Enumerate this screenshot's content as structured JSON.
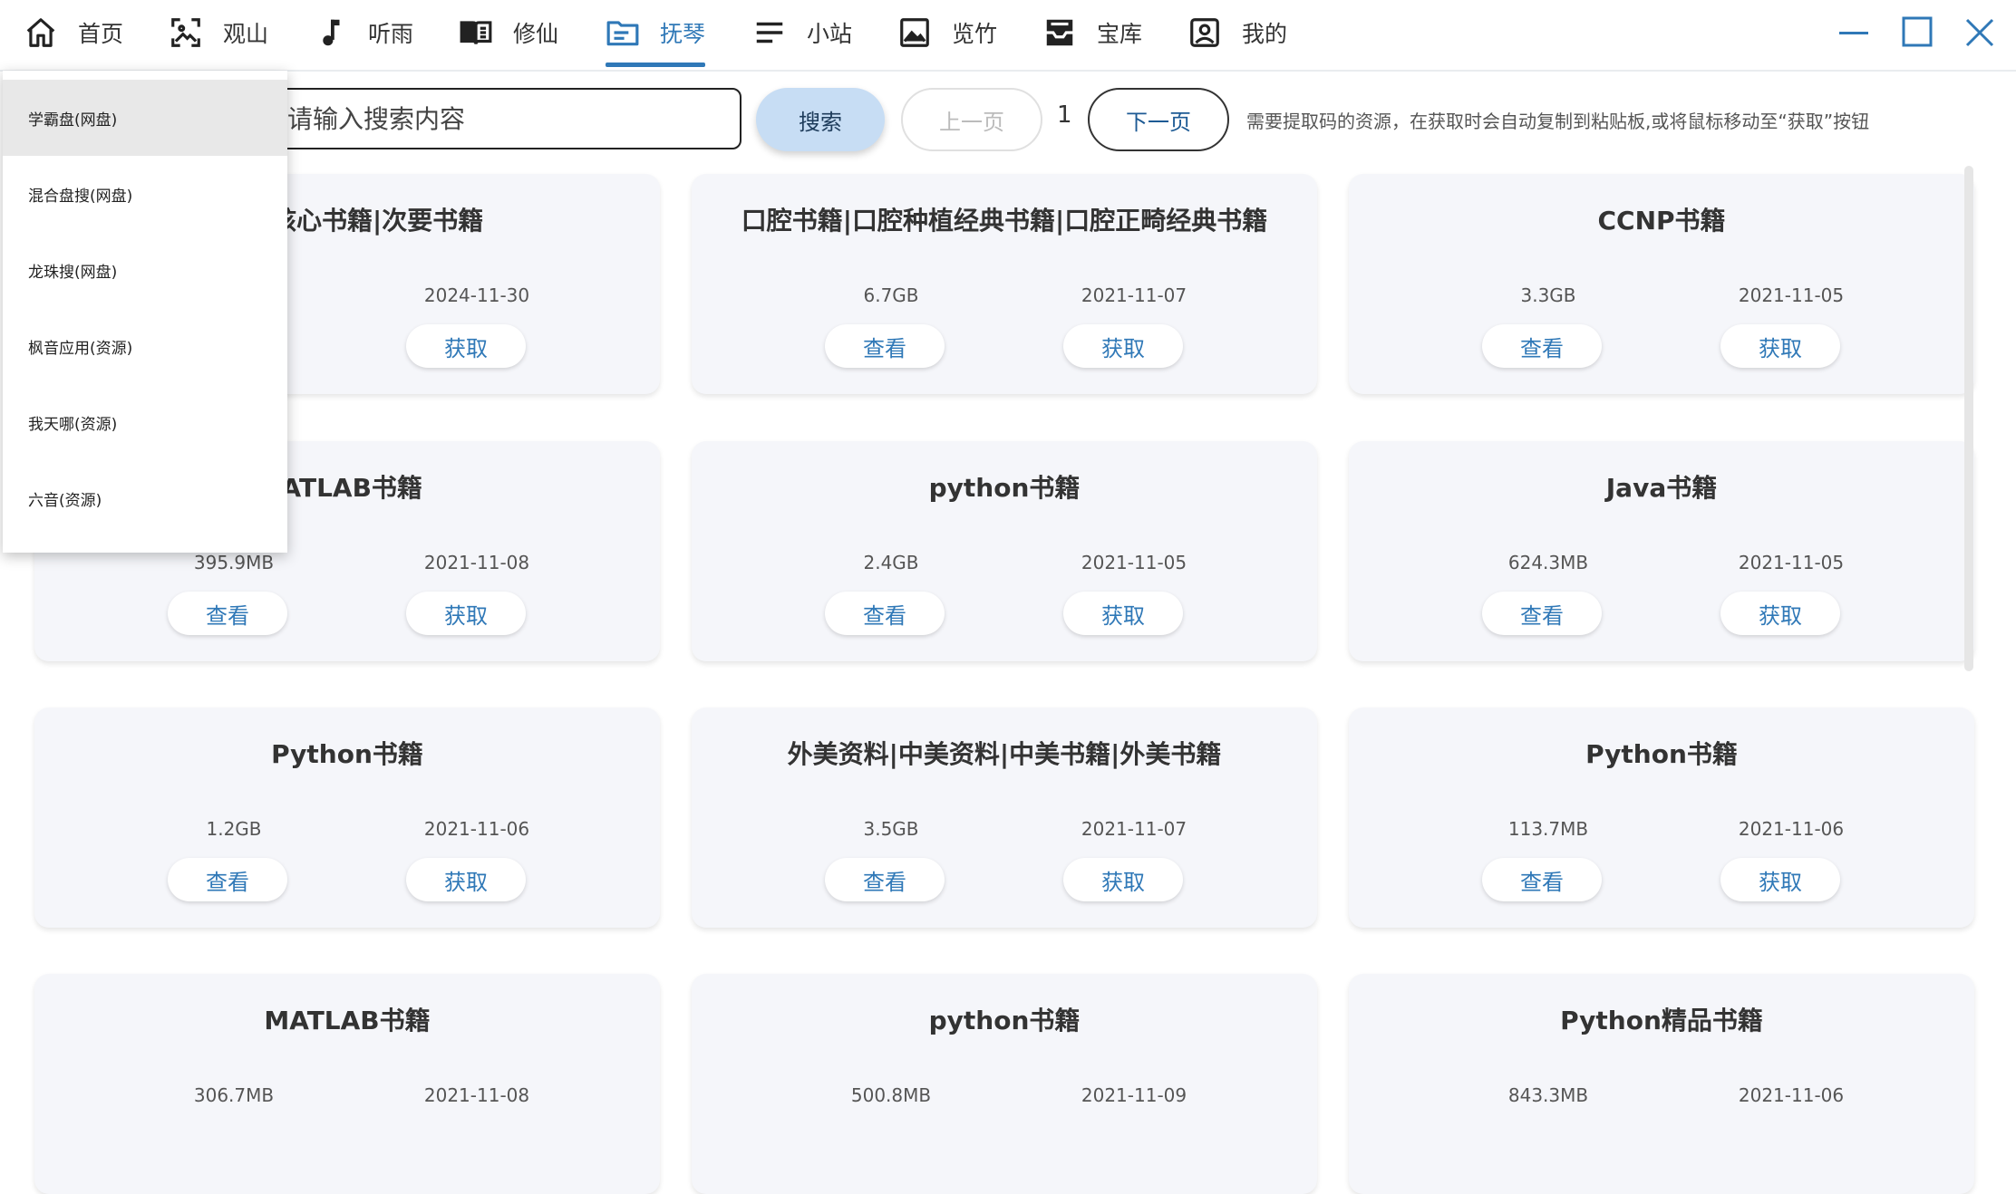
{
  "nav": {
    "items": [
      {
        "label": "首页",
        "icon": "home-icon"
      },
      {
        "label": "观山",
        "icon": "image-frame-icon"
      },
      {
        "label": "听雨",
        "icon": "music-note-icon"
      },
      {
        "label": "修仙",
        "icon": "book-icon"
      },
      {
        "label": "抚琴",
        "icon": "folder-list-icon"
      },
      {
        "label": "小站",
        "icon": "menu-lines-icon"
      },
      {
        "label": "览竹",
        "icon": "picture-icon"
      },
      {
        "label": "宝库",
        "icon": "inbox-icon"
      },
      {
        "label": "我的",
        "icon": "user-badge-icon"
      }
    ],
    "active_index": 4
  },
  "window_controls": [
    "minimize-icon",
    "maximize-icon",
    "close-icon"
  ],
  "colors": {
    "accent": "#2f78b7",
    "search_button_bg": "#c7ddf4",
    "card_bg": "#f5f6fa"
  },
  "toolbar": {
    "search_placeholder": "请输入搜索内容",
    "search_label": "搜索",
    "prev_label": "上一页",
    "page_number": "1",
    "next_label": "下一页",
    "tip": "需要提取码的资源，在获取时会自动复制到粘贴板,或将鼠标移动至“获取”按钮"
  },
  "dropdown": {
    "selected_index": 0,
    "options": [
      "学霸盘(网盘)",
      "混合盘搜(网盘)",
      "龙珠搜(网盘)",
      "枫音应用(资源)",
      "我天哪(资源)",
      "六音(资源)"
    ]
  },
  "card_buttons": {
    "view": "查看",
    "get": "获取"
  },
  "cards": [
    {
      "title": "推荐|核心书籍|次要书籍",
      "size": "",
      "date": "2024-11-30",
      "has_view": false
    },
    {
      "title": "口腔书籍|口腔种植经典书籍|口腔正畸经典书籍",
      "size": "6.7GB",
      "date": "2021-11-07",
      "has_view": true
    },
    {
      "title": "CCNP书籍",
      "size": "3.3GB",
      "date": "2021-11-05",
      "has_view": true
    },
    {
      "title": "IATLAB书籍",
      "size": "395.9MB",
      "date": "2021-11-08",
      "has_view": true
    },
    {
      "title": "python书籍",
      "size": "2.4GB",
      "date": "2021-11-05",
      "has_view": true
    },
    {
      "title": "Java书籍",
      "size": "624.3MB",
      "date": "2021-11-05",
      "has_view": true
    },
    {
      "title": "Python书籍",
      "size": "1.2GB",
      "date": "2021-11-06",
      "has_view": true
    },
    {
      "title": "外美资料|中美资料|中美书籍|外美书籍",
      "size": "3.5GB",
      "date": "2021-11-07",
      "has_view": true
    },
    {
      "title": "Python书籍",
      "size": "113.7MB",
      "date": "2021-11-06",
      "has_view": true
    },
    {
      "title": "MATLAB书籍",
      "size": "306.7MB",
      "date": "2021-11-08",
      "has_view": false
    },
    {
      "title": "python书籍",
      "size": "500.8MB",
      "date": "2021-11-09",
      "has_view": false
    },
    {
      "title": "Python精品书籍",
      "size": "843.3MB",
      "date": "2021-11-06",
      "has_view": false
    }
  ]
}
